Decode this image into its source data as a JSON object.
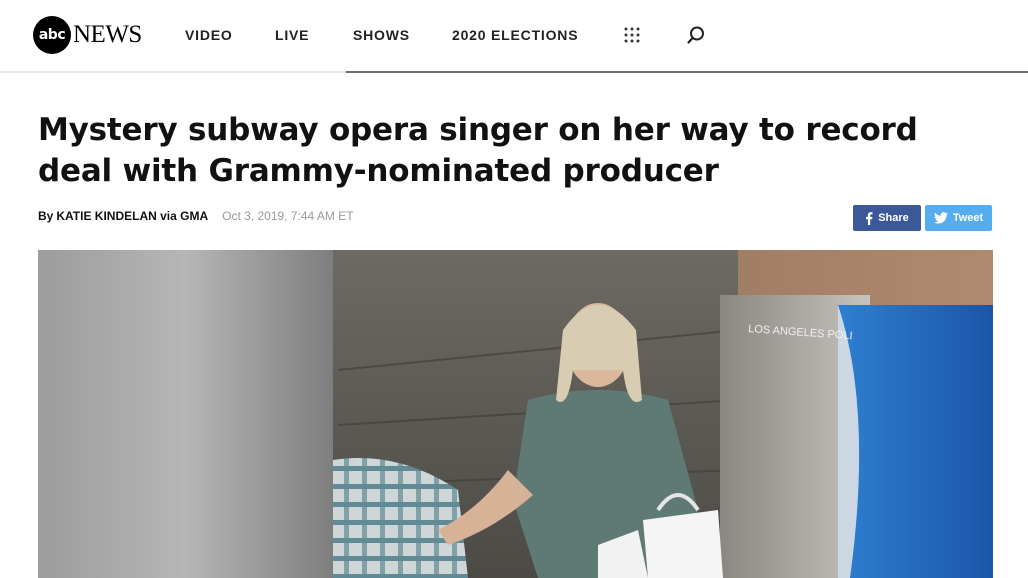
{
  "header": {
    "logo": {
      "badge": "abc",
      "wordmark": "NEWS"
    },
    "nav": [
      {
        "label": "VIDEO"
      },
      {
        "label": "LIVE"
      },
      {
        "label": "SHOWS"
      },
      {
        "label": "2020 ELECTIONS"
      }
    ],
    "icons": {
      "apps": "grid-dots-icon",
      "search": "search-icon"
    }
  },
  "article": {
    "headline": "Mystery subway opera singer on her way to record deal with Grammy-nominated producer",
    "byline": {
      "prefix": "By",
      "author": "KATIE KINDELAN via GMA",
      "date": "Oct 3, 2019, 7:44 AM ET"
    },
    "share": {
      "facebook_label": "Share",
      "twitter_label": "Tweet"
    },
    "hero": {
      "overlay_text": "LOS ANGELES POLI"
    }
  },
  "colors": {
    "facebook": "#3b5998",
    "twitter": "#55acee",
    "header_rule": "#6e6e6e",
    "byline_date": "#9a9a9a"
  }
}
